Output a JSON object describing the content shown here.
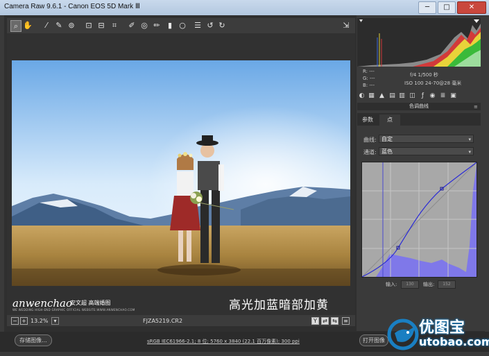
{
  "window": {
    "title": "Camera Raw 9.6.1 - Canon EOS 5D Mark Ⅲ",
    "minimize": "─",
    "maximize": "□",
    "close": "✕"
  },
  "toolbar": {
    "tools": [
      "zoom-tool",
      "hand-tool",
      "white-balance-tool",
      "color-sampler-tool",
      "targeted-adjustment-tool",
      "crop-tool",
      "straighten-tool",
      "transform-tool",
      "spot-removal-tool",
      "red-eye-tool",
      "adjustment-brush-tool",
      "graduated-filter-tool",
      "radial-filter-tool",
      "open-preferences",
      "rotate-ccw",
      "rotate-cw"
    ],
    "fullscreen_icon": "fullscreen-icon"
  },
  "photo": {
    "caption": "高光加蓝暗部加黄",
    "brand_name": "anwenchao",
    "brand_cn": "安文超 高端婚图",
    "brand_sub": "WE WEDDING HIGH-END GRAPHIC OFFICIAL WEBSITE:WWW.ANWENCHAO.COM"
  },
  "bottombar": {
    "zoom_minus": "−",
    "zoom_plus": "+",
    "zoom": "13.2%",
    "filename": "FJZA5219.CR2",
    "y_btn": "Y"
  },
  "status": {
    "save_label": "存储图像...",
    "workflow": "sRGB IEC61966-2.1; 8 位; 5760 x 3840 (22.1 百万像素); 300 ppi",
    "open_label": "打开图像"
  },
  "readout": {
    "r": "R:  ---",
    "g": "G:  ---",
    "b": "B:  ---",
    "aperture_shutter": "f/4   1/500 秒",
    "iso_lens": "ISO 100   24-70@28 毫米"
  },
  "panel": {
    "section_title": "色调曲线",
    "tabs": [
      "参数",
      "点"
    ],
    "active_tab": 1,
    "curve_label": "曲线:",
    "curve_value": "自定",
    "channel_label": "通道:",
    "channel_value": "蓝色",
    "input_label": "输入:",
    "input_value": "130",
    "output_label": "输出:",
    "output_value": "152"
  },
  "watermark": {
    "cn": "优图宝",
    "en": "utobao.com"
  },
  "colors": {
    "accent_blue": "#1a7fc2",
    "curve": "#2b2bd6",
    "panel_bg": "#3a3a3a"
  }
}
